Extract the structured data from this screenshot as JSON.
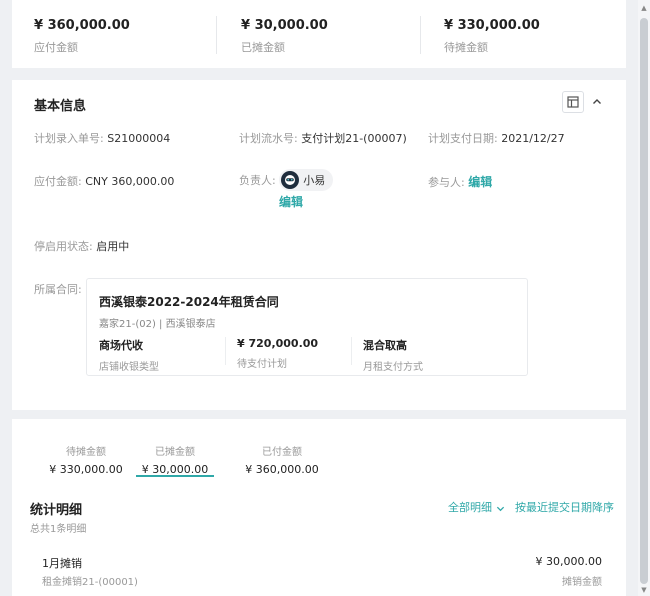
{
  "summary": {
    "payable": {
      "amount": "¥ 360,000.00",
      "label": "应付金额"
    },
    "allocated": {
      "amount": "¥ 30,000.00",
      "label": "已摊金额"
    },
    "pending": {
      "amount": "¥ 330,000.00",
      "label": "待摊金额"
    }
  },
  "basic_info": {
    "title": "基本信息",
    "plan_entry_no": {
      "label": "计划录入单号:",
      "value": "S21000004"
    },
    "plan_serial_no": {
      "label": "计划流水号:",
      "value": "支付计划21-(00007)"
    },
    "plan_pay_date": {
      "label": "计划支付日期:",
      "value": "2021/12/27"
    },
    "payable_amount": {
      "label": "应付金额:",
      "value": "CNY 360,000.00"
    },
    "owner": {
      "label": "负责人:",
      "name": "小易",
      "edit": "编辑"
    },
    "participants": {
      "label": "参与人:",
      "edit": "编辑"
    },
    "status": {
      "label": "停启用状态:",
      "value": "启用中"
    },
    "contract_label": "所属合同:",
    "contract": {
      "title": "西溪银泰2022-2024年租赁合同",
      "subtitle": "嘉家21-(02) | 西溪银泰店",
      "cells": [
        {
          "value": "商场代收",
          "label": "店铺收银类型"
        },
        {
          "value": "¥ 720,000.00",
          "label": "待支付计划"
        },
        {
          "value": "混合取高",
          "label": "月租支付方式"
        }
      ]
    }
  },
  "stats": {
    "tabs": [
      {
        "label": "待摊金额",
        "amount": "¥ 330,000.00"
      },
      {
        "label": "已摊金额",
        "amount": "¥ 30,000.00"
      },
      {
        "label": "已付金额",
        "amount": "¥ 360,000.00"
      }
    ],
    "active_tab": 1,
    "title": "统计明细",
    "subtitle": "总共1条明细",
    "filter_all": "全部明细",
    "sort": "按最近提交日期降序",
    "rows": [
      {
        "name": "1月摊销",
        "code": "租金摊销21-(00001)",
        "amount": "¥ 30,000.00",
        "amount_label": "摊销金额"
      }
    ]
  },
  "colors": {
    "accent": "#2fa8a8",
    "background": "#eef0f3"
  }
}
